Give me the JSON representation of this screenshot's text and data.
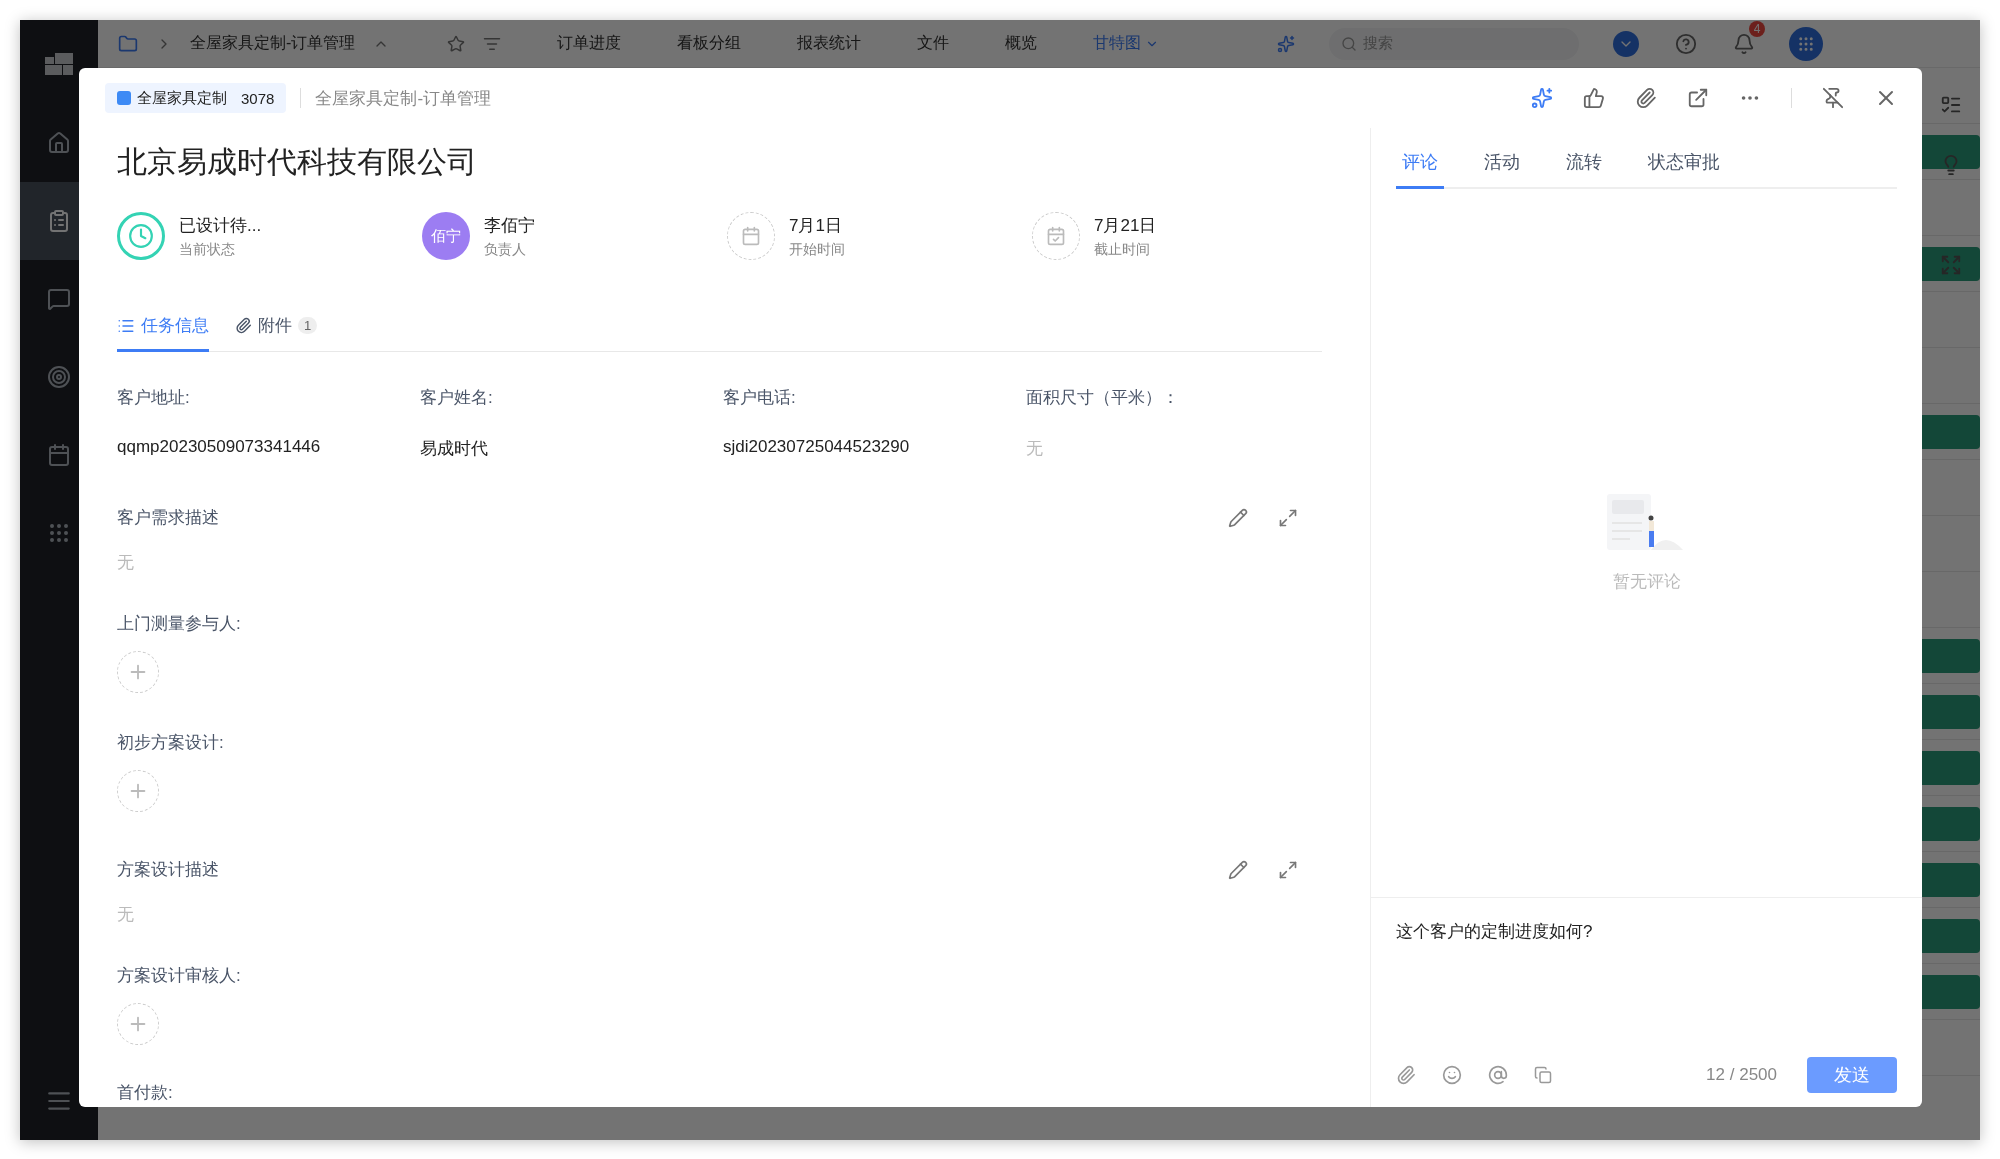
{
  "sidebar": {
    "items": [
      {
        "selected": false
      },
      {
        "selected": true
      },
      {
        "selected": false
      },
      {
        "selected": false
      },
      {
        "selected": false
      },
      {
        "selected": false
      }
    ]
  },
  "topbar": {
    "project": "全屋家具定制-订单管理",
    "views": [
      {
        "label": "订单进度",
        "selected": false
      },
      {
        "label": "看板分组",
        "selected": false
      },
      {
        "label": "报表统计",
        "selected": false
      },
      {
        "label": "文件",
        "selected": false
      },
      {
        "label": "概览",
        "selected": false
      },
      {
        "label": "甘特图",
        "selected": true
      }
    ],
    "search": {
      "placeholder": "搜索"
    },
    "notification_count": "4"
  },
  "modal": {
    "badge": {
      "project": "全屋家具定制",
      "count": "3078"
    },
    "breadcrumb": "全屋家具定制-订单管理",
    "title": "北京易成时代科技有限公司",
    "meta": [
      {
        "kind": "status",
        "value": "已设计待...",
        "label": "当前状态"
      },
      {
        "kind": "person",
        "avatar": "佰宁",
        "value": "李佰宁",
        "label": "负责人"
      },
      {
        "kind": "start",
        "value": "7月1日",
        "label": "开始时间"
      },
      {
        "kind": "due",
        "value": "7月21日",
        "label": "截止时间"
      }
    ],
    "tabs": [
      {
        "label": "任务信息",
        "selected": true
      },
      {
        "label": "附件",
        "count": "1",
        "selected": false
      }
    ],
    "fields": [
      {
        "label": "客户地址:",
        "value": "qqmp20230509073341446",
        "empty": false
      },
      {
        "label": "客户姓名:",
        "value": "易成时代",
        "empty": false
      },
      {
        "label": "客户电话:",
        "value": "sjdi20230725044523290",
        "empty": false
      },
      {
        "label": "面积尺寸（平米）：",
        "value": "无",
        "empty": true
      }
    ],
    "sections": [
      {
        "kind": "text",
        "label": "客户需求描述",
        "value": "无"
      },
      {
        "kind": "people",
        "label": "上门测量参与人:"
      },
      {
        "kind": "people",
        "label": "初步方案设计:"
      },
      {
        "kind": "text",
        "label": "方案设计描述",
        "value": "无"
      },
      {
        "kind": "people",
        "label": "方案设计审核人:"
      },
      {
        "kind": "plain",
        "label": "首付款:"
      }
    ]
  },
  "comments": {
    "tabs": [
      {
        "label": "评论",
        "selected": true
      },
      {
        "label": "活动",
        "selected": false
      },
      {
        "label": "流转",
        "selected": false
      },
      {
        "label": "状态审批",
        "selected": false
      }
    ],
    "empty_text": "暂无评论",
    "draft": "这个客户的定制进度如何?",
    "counter": "12 / 2500",
    "send": "发送"
  }
}
